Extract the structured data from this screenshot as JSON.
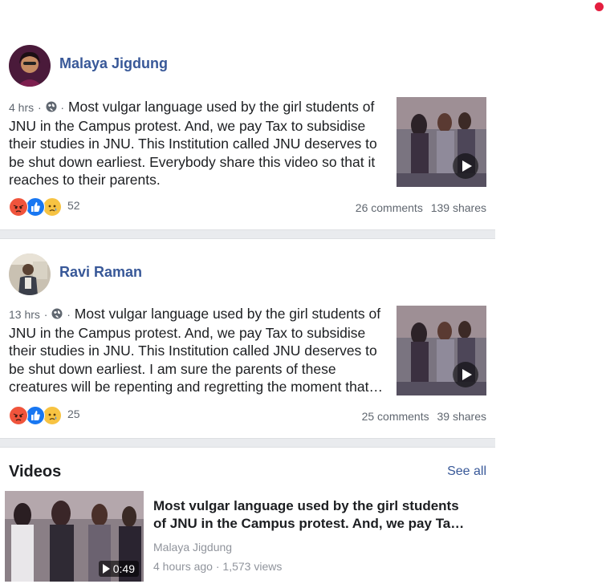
{
  "posts": [
    {
      "author": "Malaya Jigdung",
      "time": "4 hrs",
      "text": "Most vulgar language used by the girl students of JNU in the Campus protest. And, we pay Tax to subsidise their studies in JNU. This Institution called JNU deserves to be shut down earliest. Everybody share this video so that it reaches to their parents.",
      "reaction_count": "52",
      "comments": "26 comments",
      "shares": "139 shares"
    },
    {
      "author": "Ravi Raman",
      "time": "13 hrs",
      "text": "Most vulgar language used by the girl students of JNU in the Campus protest. And, we pay Tax to subsidise their studies in JNU. This Institution called JNU deserves to be shut down earliest. I am sure the parents of these creatures will be repenting and regretting the moment that…",
      "reaction_count": "25",
      "comments": "25 comments",
      "shares": "39 shares"
    }
  ],
  "separator": "·",
  "videos": {
    "title": "Videos",
    "see_all": "See all",
    "item": {
      "duration": "0:49",
      "title": "Most vulgar language used by the girl students of JNU in the Campus protest. And, we pay Ta…",
      "author": "Malaya Jigdung",
      "age": "4 hours ago",
      "views": "1,573 views"
    }
  },
  "icons": [
    "globe-icon",
    "angry-reaction-icon",
    "like-reaction-icon",
    "sad-reaction-icon",
    "play-icon"
  ],
  "colors": {
    "link": "#385898",
    "meta": "#606770",
    "divider": "#e9ebee",
    "notification": "#e41e3f"
  }
}
